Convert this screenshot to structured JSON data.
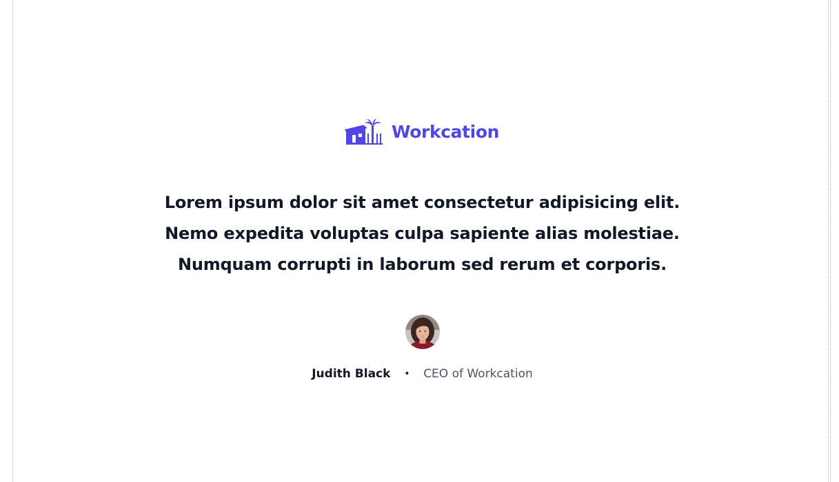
{
  "brand": {
    "name": "Workcation",
    "icon": "beach-house-palm-icon",
    "color": "#4f46e5"
  },
  "testimonial": {
    "quote_lines": [
      "Lorem ipsum dolor sit amet consectetur adipisicing elit.",
      "Nemo expedita voluptas culpa sapiente alias molestiae.",
      "Numquam corrupti in laborum sed rerum et corporis."
    ],
    "author": {
      "name": "Judith Black",
      "separator": "•",
      "role": "CEO of Workcation",
      "avatar": "woman-portrait-avatar"
    }
  }
}
